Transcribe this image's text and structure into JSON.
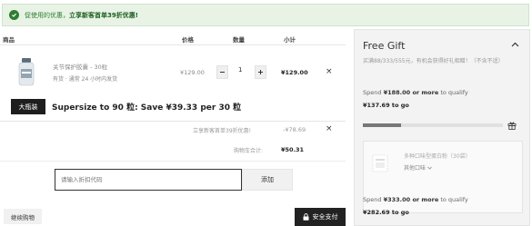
{
  "banner": {
    "message": "促使用的优惠，",
    "highlight": "立享新客首单39折优惠!"
  },
  "table": {
    "headers": {
      "product": "商品",
      "price": "价格",
      "quantity": "数量",
      "subtotal": "小计"
    }
  },
  "item": {
    "name": "关节保护胶囊 - 30粒",
    "meta": "有货 · 通常 24 小时内发货",
    "price": "¥129.00",
    "quantity": "1",
    "subtotal": "¥129.00",
    "remove_symbol": "×"
  },
  "upsell": {
    "tag": "大瓶装",
    "text": "Supersize to 90 粒: Save ¥39.33 per 30 粒"
  },
  "discount": {
    "label": "立享新客首单39折优惠!",
    "value": "-¥78.69",
    "remove_symbol": "×"
  },
  "total": {
    "label": "购物车合计:",
    "value": "¥50.31"
  },
  "promo": {
    "placeholder": "请输入折扣代码",
    "apply_label": "添加"
  },
  "actions": {
    "continue_label": "继续购物",
    "checkout_label": "安全支付"
  },
  "gift_panel": {
    "title": "Free Gift",
    "description": "买满88/333/555元，有机会获得好礼相赠！（不含不适）",
    "tier1": {
      "prefix": "Spend",
      "amount": "¥188.00 or more",
      "suffix": "to qualify",
      "remaining": "¥137.69 to go",
      "progress": 0.27
    },
    "gift": {
      "name": "多种口味型蛋白粉（30袋）",
      "select_label": "其他口味"
    },
    "tier2": {
      "prefix": "Spend",
      "amount": "¥333.00 or more",
      "suffix": "to qualify",
      "remaining": "¥282.69 to go"
    }
  },
  "colors": {
    "banner_bg": "#e8f3e6",
    "banner_text": "#2e7d32",
    "panel_bg": "#f3f3f3",
    "button_dark": "#222222"
  },
  "icons": [
    "check-circle-icon",
    "minus-icon",
    "plus-icon",
    "close-icon",
    "chevron-up-icon",
    "gift-icon",
    "chevron-down-icon",
    "lock-icon"
  ]
}
